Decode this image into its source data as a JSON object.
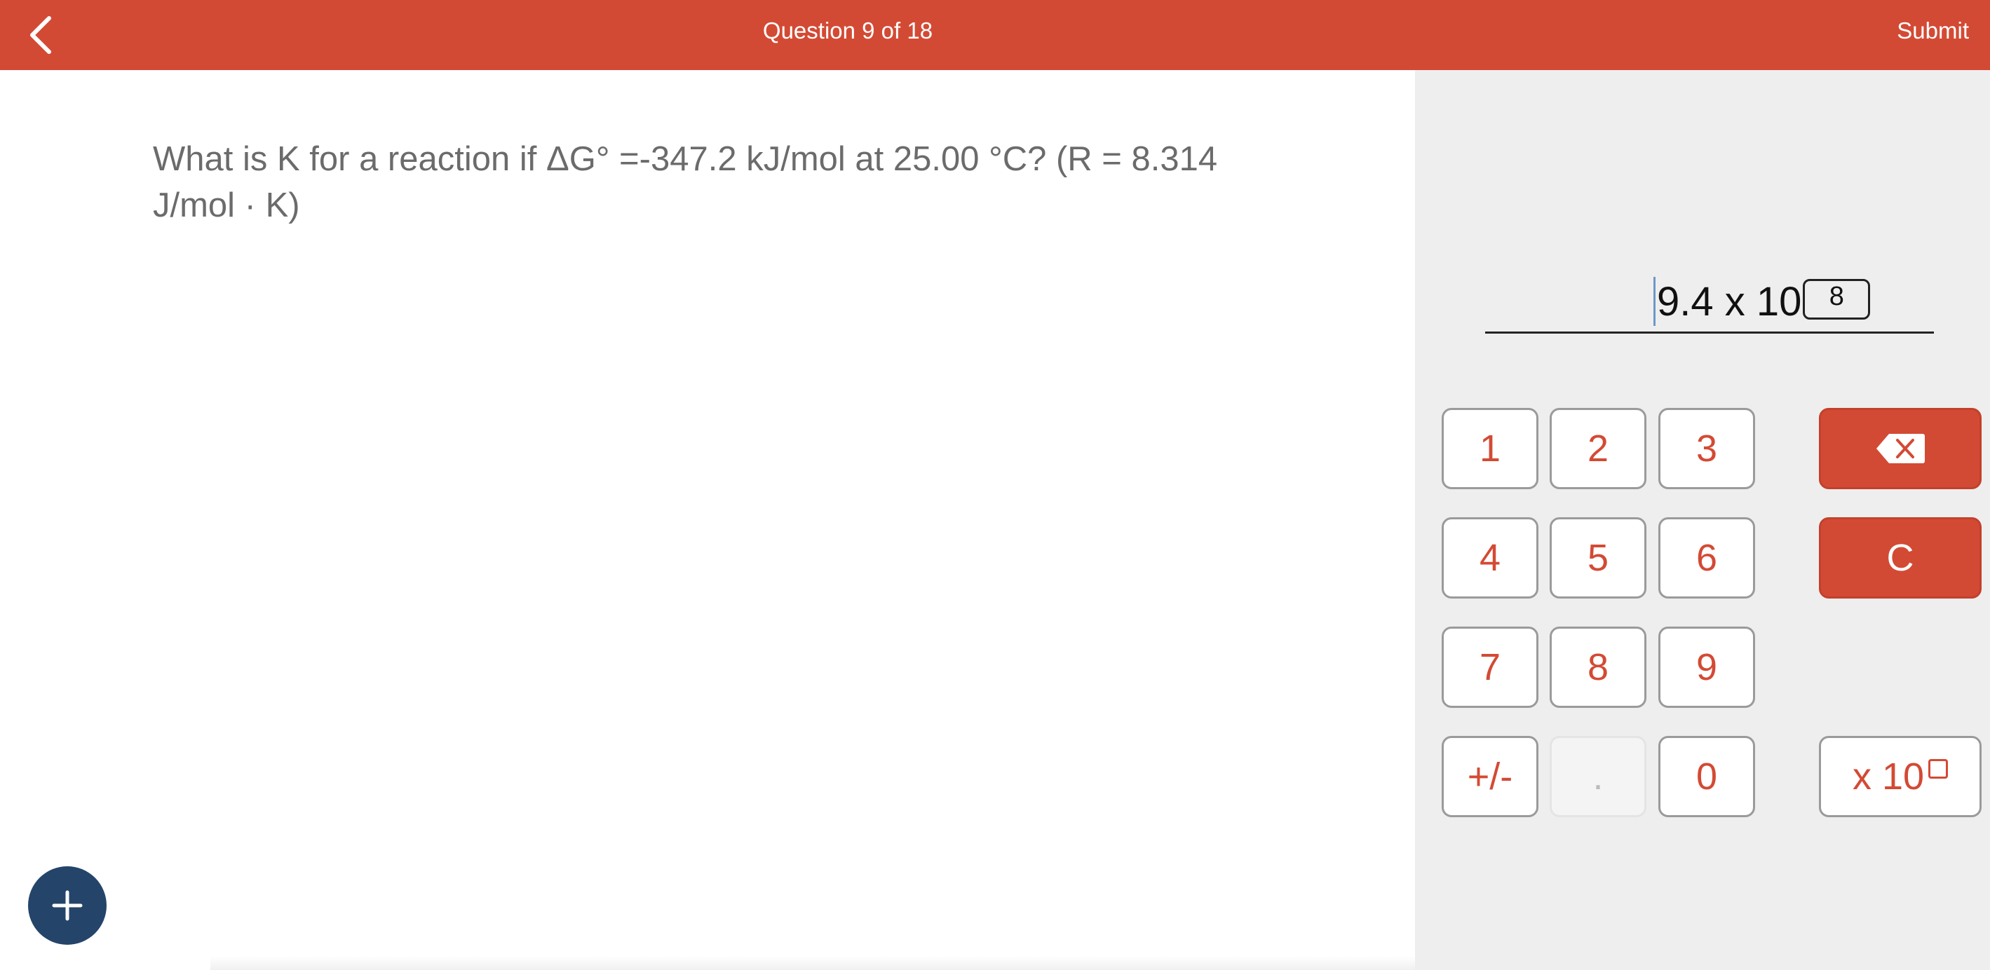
{
  "header": {
    "title": "Question 9 of 18",
    "submit_label": "Submit"
  },
  "question": {
    "line1": "What is K for a reaction if ΔG° =-347.2 kJ/mol at 25.00 °C? (R = 8.314",
    "line2": "J/mol · K)"
  },
  "answer": {
    "mantissa": "9.4 x 10",
    "exponent": "8"
  },
  "keypad": {
    "k1": "1",
    "k2": "2",
    "k3": "3",
    "k4": "4",
    "k5": "5",
    "k6": "6",
    "k7": "7",
    "k8": "8",
    "k9": "9",
    "sign": "+/-",
    "decimal": ".",
    "k0": "0",
    "clear": "C",
    "exp": "x 10"
  },
  "colors": {
    "brand": "#D34A34",
    "fab": "#24446A",
    "panel": "#EEEEEE"
  },
  "icons": {
    "back": "chevron-left-icon",
    "backspace": "backspace-icon",
    "fab": "plus-icon"
  }
}
